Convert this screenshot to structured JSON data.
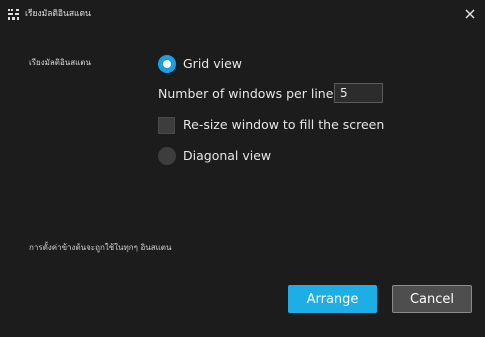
{
  "window": {
    "title": "เรียงมัลติอินสแตน",
    "close_icon": "close-icon",
    "app_icon": "grid-icon"
  },
  "layout_section": {
    "label": "เรียงมัลติอินสแตน",
    "grid_view": {
      "label": "Grid view",
      "selected": true
    },
    "windows_per_line": {
      "label": "Number of windows per line",
      "value": "5"
    },
    "resize_to_fill": {
      "label": "Re-size window to fill the screen",
      "checked": false
    },
    "diagonal_view": {
      "label": "Diagonal view",
      "selected": false
    }
  },
  "footer": {
    "note": "การตั้งค่าข้างต้นจะถูกใช้ในทุกๆ อินสแตน"
  },
  "buttons": {
    "arrange": "Arrange",
    "cancel": "Cancel"
  },
  "colors": {
    "background": "#1c1c1c",
    "accent": "#1eaee6",
    "radio_checked": "#1a9fe0",
    "control_bg": "#3d3d3d",
    "cancel_bg": "#4e4e4e"
  }
}
